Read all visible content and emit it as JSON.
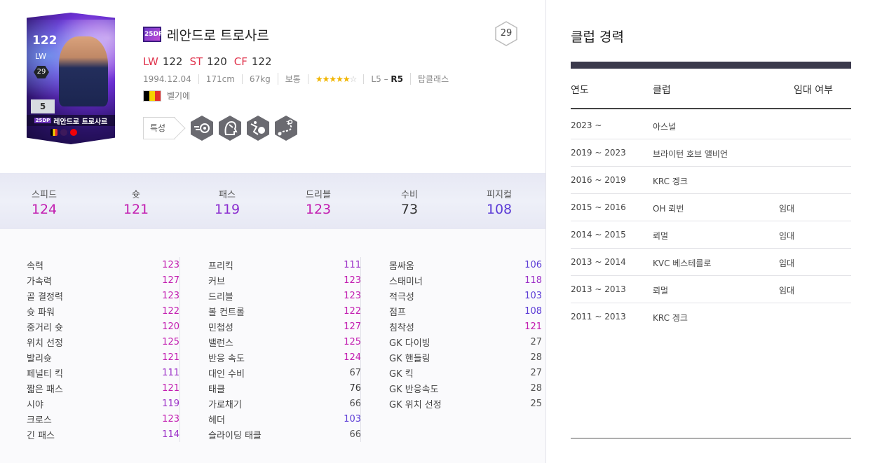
{
  "card": {
    "ovr": "122",
    "position": "LW",
    "level": "29",
    "number": "5",
    "name": "레안드로 트로사르",
    "season_mini": "25DP"
  },
  "player": {
    "season_badge": "25DP",
    "name": "레안드로 트로사르",
    "level": "29",
    "positions": [
      {
        "code": "LW",
        "value": "122"
      },
      {
        "code": "ST",
        "value": "120"
      },
      {
        "code": "CF",
        "value": "122"
      }
    ],
    "birth": "1994.12.04",
    "height": "171cm",
    "weight": "67kg",
    "body": "보통",
    "skill_stars_on": "★★★★★",
    "skill_stars_off": "☆",
    "foot_left": "L5",
    "foot_sep": " – ",
    "foot_right": "R5",
    "club": "탑클래스",
    "nation": "벨기에",
    "trait_label": "특성",
    "traits": [
      "trait-icon-1",
      "trait-icon-2",
      "trait-icon-3",
      "trait-icon-4"
    ]
  },
  "summary": [
    {
      "label": "스피드",
      "value": "124",
      "color": "#c21cb0"
    },
    {
      "label": "슛",
      "value": "121",
      "color": "#c21cb0"
    },
    {
      "label": "패스",
      "value": "119",
      "color": "#8a2ccf"
    },
    {
      "label": "드리블",
      "value": "123",
      "color": "#c21cb0"
    },
    {
      "label": "수비",
      "value": "73",
      "color": "#333333"
    },
    {
      "label": "피지컬",
      "value": "108",
      "color": "#5b3bd6"
    }
  ],
  "stats": {
    "col1": [
      {
        "name": "속력",
        "value": "123"
      },
      {
        "name": "가속력",
        "value": "127"
      },
      {
        "name": "골 결정력",
        "value": "123"
      },
      {
        "name": "슛 파워",
        "value": "122"
      },
      {
        "name": "중거리 슛",
        "value": "120"
      },
      {
        "name": "위치 선정",
        "value": "125"
      },
      {
        "name": "발리슛",
        "value": "121"
      },
      {
        "name": "페널티 킥",
        "value": "111"
      },
      {
        "name": "짧은 패스",
        "value": "121"
      },
      {
        "name": "시야",
        "value": "119"
      },
      {
        "name": "크로스",
        "value": "123"
      },
      {
        "name": "긴 패스",
        "value": "114"
      }
    ],
    "col2": [
      {
        "name": "프리킥",
        "value": "111"
      },
      {
        "name": "커브",
        "value": "123"
      },
      {
        "name": "드리블",
        "value": "123"
      },
      {
        "name": "볼 컨트롤",
        "value": "122"
      },
      {
        "name": "민첩성",
        "value": "127"
      },
      {
        "name": "밸런스",
        "value": "125"
      },
      {
        "name": "반응 속도",
        "value": "124"
      },
      {
        "name": "대인 수비",
        "value": "67"
      },
      {
        "name": "태클",
        "value": "76"
      },
      {
        "name": "가로채기",
        "value": "66"
      },
      {
        "name": "헤더",
        "value": "103"
      },
      {
        "name": "슬라이딩 태클",
        "value": "66"
      }
    ],
    "col3": [
      {
        "name": "몸싸움",
        "value": "106"
      },
      {
        "name": "스태미너",
        "value": "118"
      },
      {
        "name": "적극성",
        "value": "103"
      },
      {
        "name": "점프",
        "value": "108"
      },
      {
        "name": "침착성",
        "value": "121"
      },
      {
        "name": "GK 다이빙",
        "value": "27"
      },
      {
        "name": "GK 핸들링",
        "value": "28"
      },
      {
        "name": "GK 킥",
        "value": "27"
      },
      {
        "name": "GK 반응속도",
        "value": "28"
      },
      {
        "name": "GK 위치 선정",
        "value": "25"
      }
    ]
  },
  "club_history": {
    "title": "클럽 경력",
    "headers": {
      "year": "연도",
      "club": "클럽",
      "loan": "임대 여부"
    },
    "rows": [
      {
        "year": "2023 ~",
        "club": "아스널",
        "loan": ""
      },
      {
        "year": "2019 ~ 2023",
        "club": "브라이턴 호브 앨비언",
        "loan": ""
      },
      {
        "year": "2016 ~ 2019",
        "club": "KRC 겡크",
        "loan": ""
      },
      {
        "year": "2015 ~ 2016",
        "club": "OH 뢰번",
        "loan": "임대"
      },
      {
        "year": "2014 ~ 2015",
        "club": "뢰멀",
        "loan": "임대"
      },
      {
        "year": "2013 ~ 2014",
        "club": "KVC 베스테를로",
        "loan": "임대"
      },
      {
        "year": "2013 ~ 2013",
        "club": "뢰멀",
        "loan": "임대"
      },
      {
        "year": "2011 ~ 2013",
        "club": "KRC 겡크",
        "loan": ""
      }
    ]
  }
}
